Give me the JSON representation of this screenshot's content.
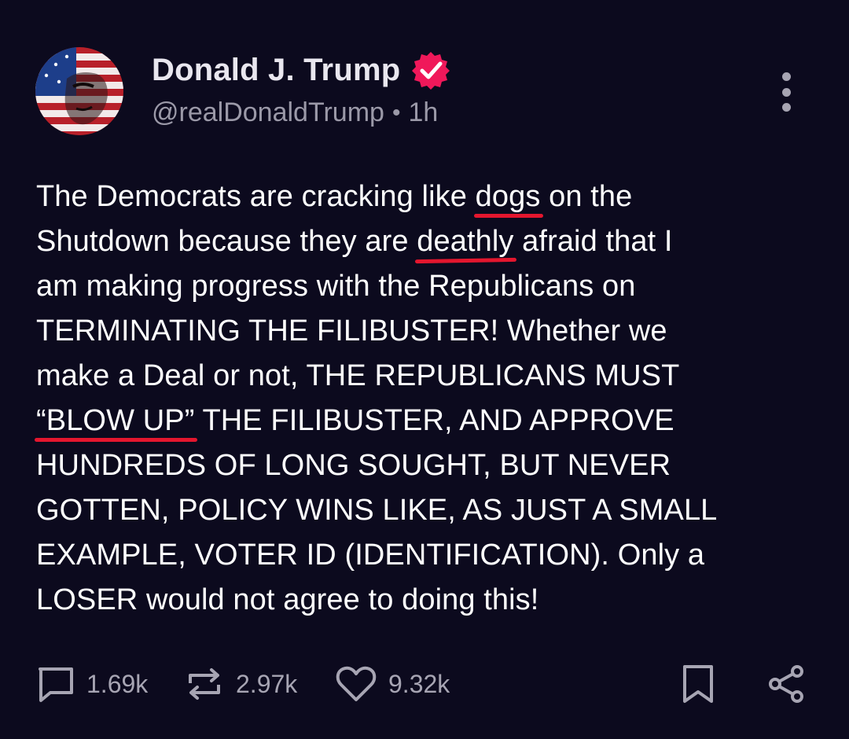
{
  "author": {
    "display_name": "Donald J. Trump",
    "handle": "@realDonaldTrump",
    "separator": "•",
    "time": "1h",
    "verified_icon": "verified-check-badge",
    "verified_color": "#f0185a",
    "avatar_desc_icon": "profile-avatar"
  },
  "menu": {
    "icon": "more-vertical-icon"
  },
  "post": {
    "lines": [
      {
        "pre": "The Democrats are cracking like ",
        "ul": "dogs",
        "post": " on the"
      },
      {
        "pre": "Shutdown because they are ",
        "ul": "deathly",
        "post": " afraid that I"
      },
      {
        "pre": "am making progress with the Republicans on",
        "ul": "",
        "post": ""
      },
      {
        "pre": "TERMINATING THE FILIBUSTER! Whether we",
        "ul": "",
        "post": ""
      },
      {
        "pre": "make a Deal or not, THE REPUBLICANS MUST",
        "ul": "",
        "post": ""
      },
      {
        "pre": "",
        "ul": "“BLOW UP”",
        "post": " THE FILIBUSTER, AND APPROVE"
      },
      {
        "pre": "HUNDREDS OF LONG SOUGHT, BUT NEVER",
        "ul": "",
        "post": ""
      },
      {
        "pre": "GOTTEN, POLICY WINS LIKE, AS JUST A SMALL",
        "ul": "",
        "post": ""
      },
      {
        "pre": "EXAMPLE, VOTER ID (IDENTIFICATION). Only a",
        "ul": "",
        "post": ""
      },
      {
        "pre": "LOSER would not agree to doing this!",
        "ul": "",
        "post": ""
      }
    ],
    "underline_color": "#e4162e"
  },
  "actions": {
    "replies": {
      "count": "1.69k",
      "icon": "comment-icon"
    },
    "reposts": {
      "count": "2.97k",
      "icon": "repost-icon"
    },
    "likes": {
      "count": "9.32k",
      "icon": "heart-icon"
    },
    "bookmark": {
      "icon": "bookmark-icon"
    },
    "share": {
      "icon": "share-icon"
    }
  },
  "colors": {
    "background": "#0c0a1e",
    "text": "#ffffff",
    "muted": "#9b99a8"
  }
}
